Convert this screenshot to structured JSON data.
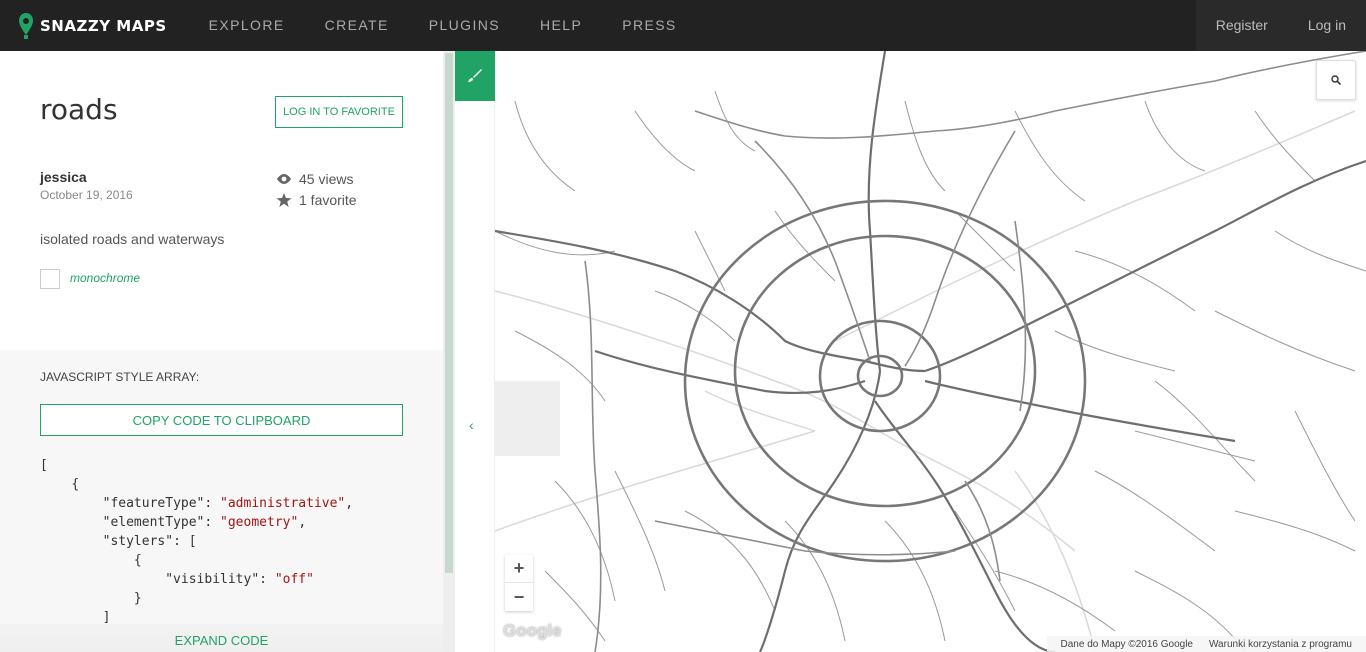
{
  "nav": {
    "brand": "SNAZZY MAPS",
    "links": [
      "EXPLORE",
      "CREATE",
      "PLUGINS",
      "HELP",
      "PRESS"
    ],
    "register": "Register",
    "login": "Log in"
  },
  "style": {
    "title": "roads",
    "favorite_button": "LOG IN TO FAVORITE",
    "author": "jessica",
    "date": "October 19, 2016",
    "views": "45 views",
    "favorites": "1 favorite",
    "description": "isolated roads and waterways",
    "tag": "monochrome"
  },
  "code": {
    "heading": "JAVASCRIPT STYLE ARRAY:",
    "copy_button": "COPY CODE TO CLIPBOARD",
    "lines": {
      "l1": "[",
      "l2": "{",
      "k3": "\"featureType\"",
      "v3": "\"administrative\"",
      "k4": "\"elementType\"",
      "v4": "\"geometry\"",
      "k5": "\"stylers\"",
      "l6": "{",
      "k7": "\"visibility\"",
      "v7": "\"off\"",
      "l8": "}",
      "l9": "]"
    },
    "expand": "EXPAND CODE"
  },
  "map": {
    "zoom_in": "+",
    "zoom_out": "−",
    "google": "Google",
    "attribution": "Dane do Mapy ©2016 Google",
    "terms": "Warunki korzystania z programu"
  },
  "colors": {
    "accent": "#21a366",
    "nav_bg": "#222222"
  }
}
